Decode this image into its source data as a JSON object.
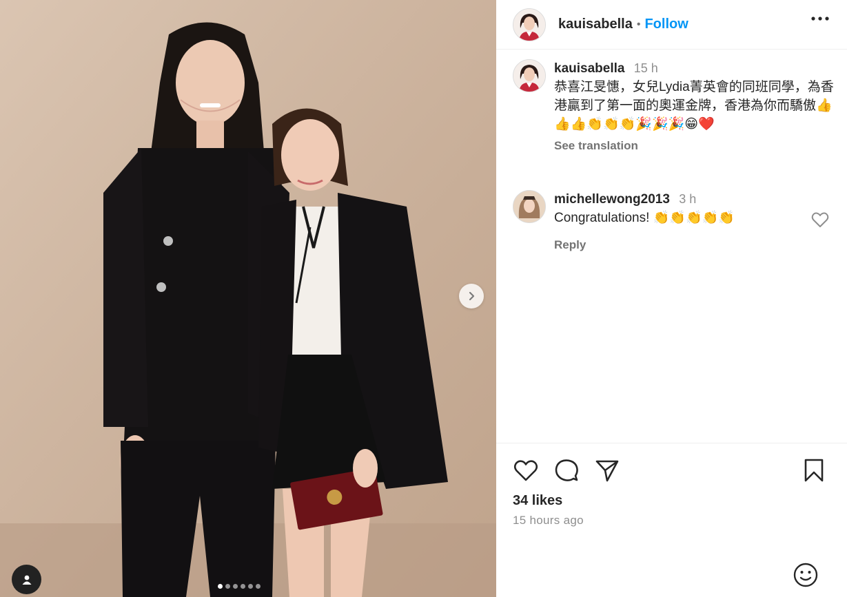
{
  "post": {
    "username": "kauisabella",
    "follow_label": "Follow",
    "separator": "•",
    "media": {
      "slide_count": 6,
      "active_slide": 1
    }
  },
  "caption": {
    "username": "kauisabella",
    "time": "15 h",
    "text": "恭喜江旻憓，女兒Lydia菁英會的同班同學，為香港贏到了第一面的奧運金牌，香港為你而驕傲",
    "emojis": "👍👍👍👏👏👏🎉🎉🎉😁❤️",
    "see_translation": "See translation"
  },
  "comment": {
    "username": "michellewong2013",
    "time": "3 h",
    "text": "Congratulations!",
    "emojis": "👏👏👏👏👏",
    "reply_label": "Reply"
  },
  "stats": {
    "likes": "34 likes",
    "posted_time": "15 hours ago"
  },
  "icons": {
    "more": "more-options-icon",
    "like": "heart-icon",
    "comment": "comment-bubble-icon",
    "share": "paper-plane-icon",
    "save": "bookmark-icon",
    "emoji": "smiley-icon",
    "next": "chevron-right-icon",
    "tag": "user-tag-icon"
  },
  "colors": {
    "accent": "#0095f6",
    "text": "#262626",
    "muted": "#8e8e8e",
    "divider": "#efefef",
    "backdrop": "#cdb39d"
  }
}
